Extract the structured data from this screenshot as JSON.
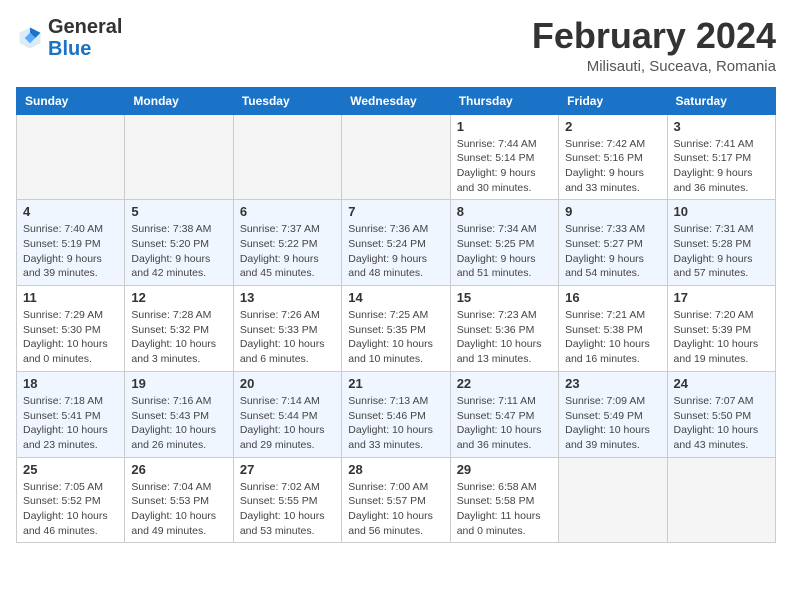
{
  "header": {
    "logo_general": "General",
    "logo_blue": "Blue",
    "month_title": "February 2024",
    "subtitle": "Milisauti, Suceava, Romania"
  },
  "days_of_week": [
    "Sunday",
    "Monday",
    "Tuesday",
    "Wednesday",
    "Thursday",
    "Friday",
    "Saturday"
  ],
  "weeks": [
    {
      "days": [
        {
          "num": "",
          "info": ""
        },
        {
          "num": "",
          "info": ""
        },
        {
          "num": "",
          "info": ""
        },
        {
          "num": "",
          "info": ""
        },
        {
          "num": "1",
          "info": "Sunrise: 7:44 AM\nSunset: 5:14 PM\nDaylight: 9 hours and 30 minutes."
        },
        {
          "num": "2",
          "info": "Sunrise: 7:42 AM\nSunset: 5:16 PM\nDaylight: 9 hours and 33 minutes."
        },
        {
          "num": "3",
          "info": "Sunrise: 7:41 AM\nSunset: 5:17 PM\nDaylight: 9 hours and 36 minutes."
        }
      ]
    },
    {
      "days": [
        {
          "num": "4",
          "info": "Sunrise: 7:40 AM\nSunset: 5:19 PM\nDaylight: 9 hours and 39 minutes."
        },
        {
          "num": "5",
          "info": "Sunrise: 7:38 AM\nSunset: 5:20 PM\nDaylight: 9 hours and 42 minutes."
        },
        {
          "num": "6",
          "info": "Sunrise: 7:37 AM\nSunset: 5:22 PM\nDaylight: 9 hours and 45 minutes."
        },
        {
          "num": "7",
          "info": "Sunrise: 7:36 AM\nSunset: 5:24 PM\nDaylight: 9 hours and 48 minutes."
        },
        {
          "num": "8",
          "info": "Sunrise: 7:34 AM\nSunset: 5:25 PM\nDaylight: 9 hours and 51 minutes."
        },
        {
          "num": "9",
          "info": "Sunrise: 7:33 AM\nSunset: 5:27 PM\nDaylight: 9 hours and 54 minutes."
        },
        {
          "num": "10",
          "info": "Sunrise: 7:31 AM\nSunset: 5:28 PM\nDaylight: 9 hours and 57 minutes."
        }
      ]
    },
    {
      "days": [
        {
          "num": "11",
          "info": "Sunrise: 7:29 AM\nSunset: 5:30 PM\nDaylight: 10 hours and 0 minutes."
        },
        {
          "num": "12",
          "info": "Sunrise: 7:28 AM\nSunset: 5:32 PM\nDaylight: 10 hours and 3 minutes."
        },
        {
          "num": "13",
          "info": "Sunrise: 7:26 AM\nSunset: 5:33 PM\nDaylight: 10 hours and 6 minutes."
        },
        {
          "num": "14",
          "info": "Sunrise: 7:25 AM\nSunset: 5:35 PM\nDaylight: 10 hours and 10 minutes."
        },
        {
          "num": "15",
          "info": "Sunrise: 7:23 AM\nSunset: 5:36 PM\nDaylight: 10 hours and 13 minutes."
        },
        {
          "num": "16",
          "info": "Sunrise: 7:21 AM\nSunset: 5:38 PM\nDaylight: 10 hours and 16 minutes."
        },
        {
          "num": "17",
          "info": "Sunrise: 7:20 AM\nSunset: 5:39 PM\nDaylight: 10 hours and 19 minutes."
        }
      ]
    },
    {
      "days": [
        {
          "num": "18",
          "info": "Sunrise: 7:18 AM\nSunset: 5:41 PM\nDaylight: 10 hours and 23 minutes."
        },
        {
          "num": "19",
          "info": "Sunrise: 7:16 AM\nSunset: 5:43 PM\nDaylight: 10 hours and 26 minutes."
        },
        {
          "num": "20",
          "info": "Sunrise: 7:14 AM\nSunset: 5:44 PM\nDaylight: 10 hours and 29 minutes."
        },
        {
          "num": "21",
          "info": "Sunrise: 7:13 AM\nSunset: 5:46 PM\nDaylight: 10 hours and 33 minutes."
        },
        {
          "num": "22",
          "info": "Sunrise: 7:11 AM\nSunset: 5:47 PM\nDaylight: 10 hours and 36 minutes."
        },
        {
          "num": "23",
          "info": "Sunrise: 7:09 AM\nSunset: 5:49 PM\nDaylight: 10 hours and 39 minutes."
        },
        {
          "num": "24",
          "info": "Sunrise: 7:07 AM\nSunset: 5:50 PM\nDaylight: 10 hours and 43 minutes."
        }
      ]
    },
    {
      "days": [
        {
          "num": "25",
          "info": "Sunrise: 7:05 AM\nSunset: 5:52 PM\nDaylight: 10 hours and 46 minutes."
        },
        {
          "num": "26",
          "info": "Sunrise: 7:04 AM\nSunset: 5:53 PM\nDaylight: 10 hours and 49 minutes."
        },
        {
          "num": "27",
          "info": "Sunrise: 7:02 AM\nSunset: 5:55 PM\nDaylight: 10 hours and 53 minutes."
        },
        {
          "num": "28",
          "info": "Sunrise: 7:00 AM\nSunset: 5:57 PM\nDaylight: 10 hours and 56 minutes."
        },
        {
          "num": "29",
          "info": "Sunrise: 6:58 AM\nSunset: 5:58 PM\nDaylight: 11 hours and 0 minutes."
        },
        {
          "num": "",
          "info": ""
        },
        {
          "num": "",
          "info": ""
        }
      ]
    }
  ]
}
